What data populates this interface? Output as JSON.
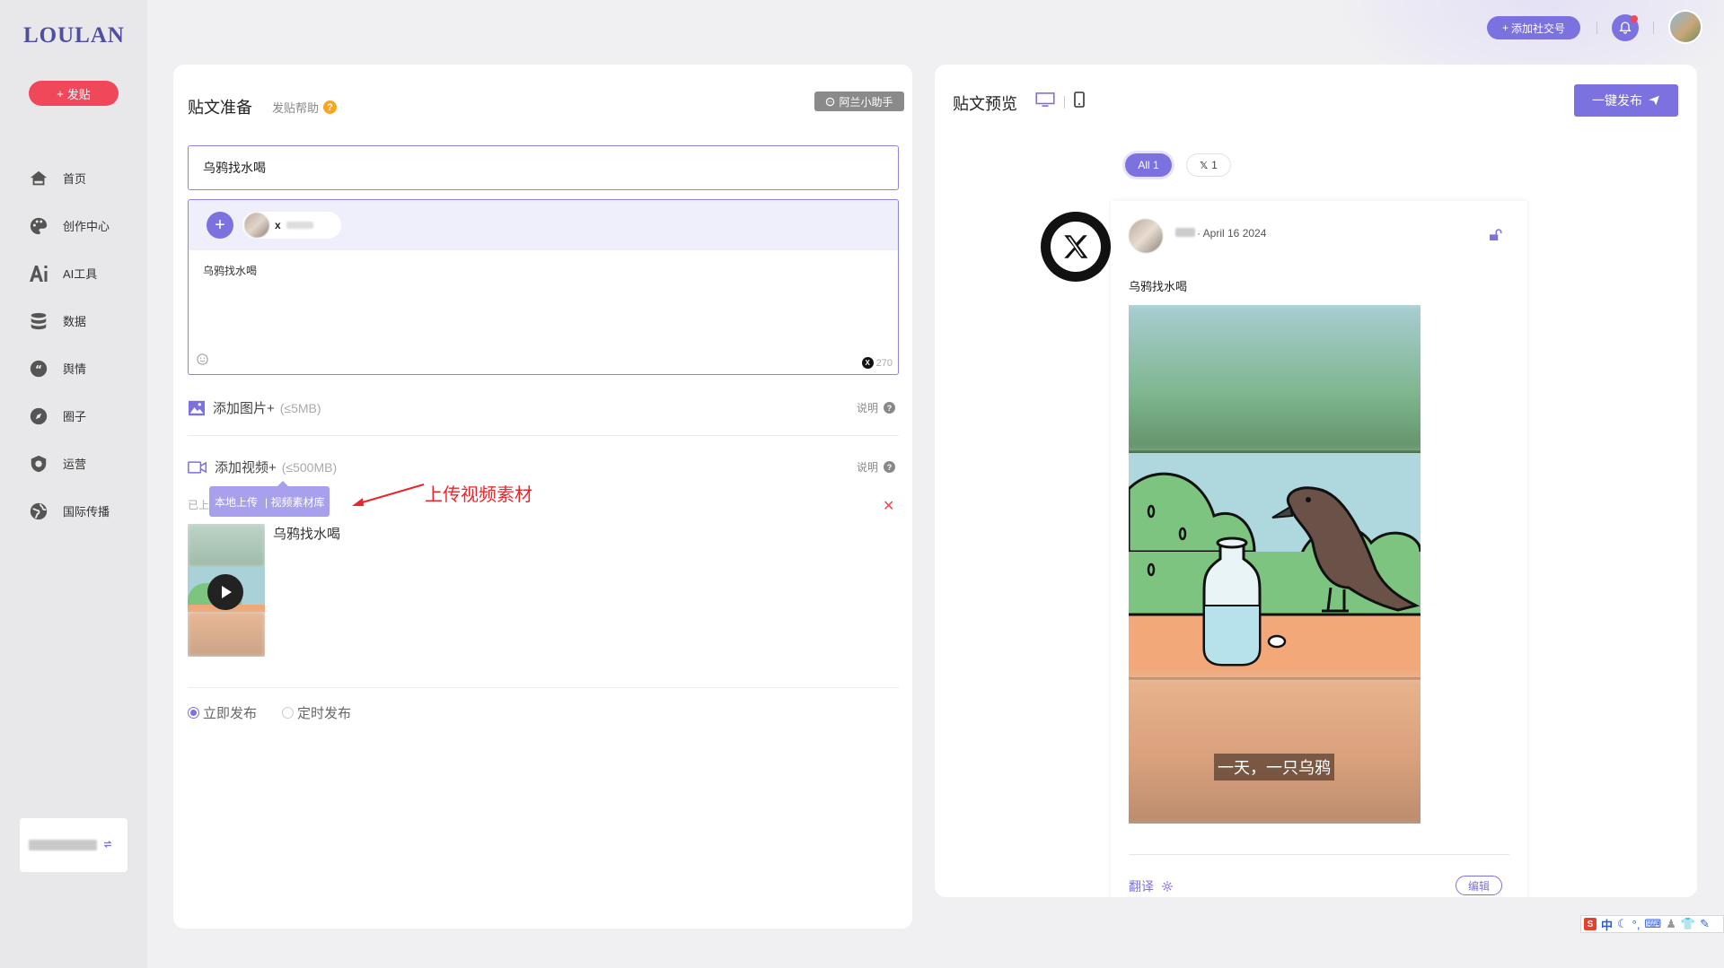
{
  "app": {
    "logo": "LOULAN"
  },
  "sidebar": {
    "post_label": "发贴",
    "items": [
      {
        "label": "首页",
        "icon": "home-icon"
      },
      {
        "label": "创作中心",
        "icon": "palette-icon"
      },
      {
        "label": "AI工具",
        "icon": "ai-icon"
      },
      {
        "label": "数据",
        "icon": "database-icon"
      },
      {
        "label": "舆情",
        "icon": "quote-icon"
      },
      {
        "label": "圈子",
        "icon": "compass-icon"
      },
      {
        "label": "运营",
        "icon": "shield-icon"
      },
      {
        "label": "国际传播",
        "icon": "globe-icon"
      }
    ]
  },
  "header": {
    "add_social_label": "添加社交号"
  },
  "compose": {
    "title": "贴文准备",
    "help_label": "发贴帮助",
    "assistant_label": "阿兰小助手",
    "title_input_value": "乌鸦找水喝",
    "account_chip_platform": "x",
    "body_text": "乌鸦找水喝",
    "char_count": "270",
    "add_image_label": "添加图片+",
    "add_image_hint": "(≤5MB)",
    "add_video_label": "添加视频+",
    "add_video_hint": "(≤500MB)",
    "explain_label": "说明",
    "uploaded_label": "已上",
    "popup_local": "本地上传",
    "popup_library": "| 视频素材库",
    "video_name": "乌鸦找水喝",
    "publish_now": "立即发布",
    "publish_scheduled": "定时发布"
  },
  "annotation": {
    "text": "上传视频素材",
    "color": "#e8262b"
  },
  "preview": {
    "title": "贴文预览",
    "publish_label": "一键发布",
    "filter_all": "All 1",
    "filter_x_count": "1",
    "date": "· April 16 2024",
    "post_text": "乌鸦找水喝",
    "video_caption": "一天，一只乌鸦",
    "translate_label": "翻译",
    "edit_label": "编辑"
  },
  "ime": {
    "label": "中"
  },
  "colors": {
    "accent": "#7b72e0",
    "danger": "#f0485a",
    "brand": "#4f4ea1"
  }
}
